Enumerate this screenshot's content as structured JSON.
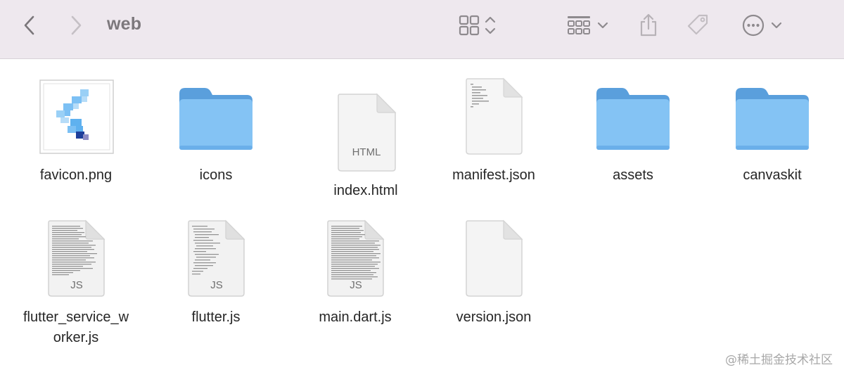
{
  "window": {
    "title": "web"
  },
  "toolbar": {
    "back_icon": "chevron-left-icon",
    "forward_icon": "chevron-right-icon",
    "view_icon": "grid-view-icon",
    "view_toggle_icon": "up-down-chevron-icon",
    "group_icon": "group-by-icon",
    "group_dropdown_icon": "chevron-down-icon",
    "share_icon": "share-icon",
    "tag_icon": "tag-icon",
    "more_icon": "ellipsis-circle-icon",
    "more_dropdown_icon": "chevron-down-icon"
  },
  "files": [
    {
      "name": "favicon.png",
      "kind": "image"
    },
    {
      "name": "icons",
      "kind": "folder"
    },
    {
      "name": "index.html",
      "kind": "document",
      "badge": "HTML"
    },
    {
      "name": "manifest.json",
      "kind": "text-document"
    },
    {
      "name": "assets",
      "kind": "folder"
    },
    {
      "name": "canvaskit",
      "kind": "folder"
    },
    {
      "name": "flutter_service_w",
      "name_line2": "orker.js",
      "kind": "script",
      "badge": "JS"
    },
    {
      "name": "flutter.js",
      "kind": "script",
      "badge": "JS"
    },
    {
      "name": "main.dart.js",
      "kind": "script",
      "badge": "JS"
    },
    {
      "name": "version.json",
      "kind": "document"
    }
  ],
  "watermark": "@稀土掘金技术社区",
  "colors": {
    "toolbar_bg": "#eee8ee",
    "folder_front": "#84c3f4",
    "folder_back": "#5a9fdc",
    "icon_gray": "#9a969a"
  }
}
